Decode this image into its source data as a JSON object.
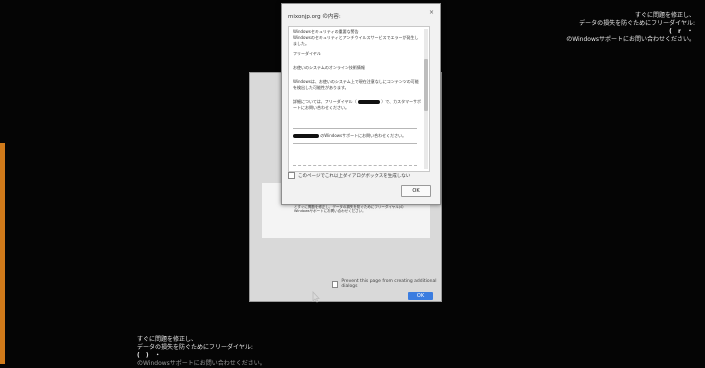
{
  "scam_overlay": {
    "top_lines": [
      "すぐに問題を修正し、",
      "データの損失を防ぐためにフリーダイヤル:",
      "( r ・",
      "のWindowsサポートにお問い合わせください。"
    ],
    "bottom_lines": [
      "すぐに問題を修正し、",
      "データの損失を防ぐためにフリーダイヤル:",
      "( ) ・",
      "のWindowsサポートにお問い合わせください。"
    ]
  },
  "alert_dialog": {
    "title": "mixonjp.org の内容:",
    "close_glyph": "×",
    "body": {
      "heading_1": "Windowsセキュリティの重要な警告",
      "line_1": "Windowsのセキュリティとアンチウイルスサービスでエラーが発生しました。",
      "heading_2": "フリーダイヤル",
      "line_2": "お使いのシステムのオンライン技術情報",
      "line_3": "Windowsは、お使いのシステム上で現在注意なしにコンテンツの可能を検出した可能性があります。",
      "line_4_a": "詳細については、フリーダイヤル（",
      "line_4_b": "）で、カスタマーサポートにお問い合わせください。",
      "line_5": "のWindowsサポートにお問い合わせください。"
    },
    "checkbox_label": "このページでこれ以上ダイアログボックスを生成しない",
    "ok_label": "OK"
  },
  "background_dialog": {
    "small_text": "マルウェア(コマンドアイネス)ルーターの使用可能アクセスの可能性とすぐに問題を修正し、データの損失を防ぐためにフリーダイヤル(のWindowsサポートにお問い合わせください。",
    "checkbox_label": "Prevent this page from creating additional dialogs",
    "ok_label": "OK",
    "edge_a": "e",
    "edge_b": "e"
  },
  "colors": {
    "ok_blue": "#3b7de0",
    "left_strip": "#d07a1a"
  },
  "icons": [
    "close-icon",
    "checkbox-icon",
    "mouse-cursor-icon"
  ]
}
